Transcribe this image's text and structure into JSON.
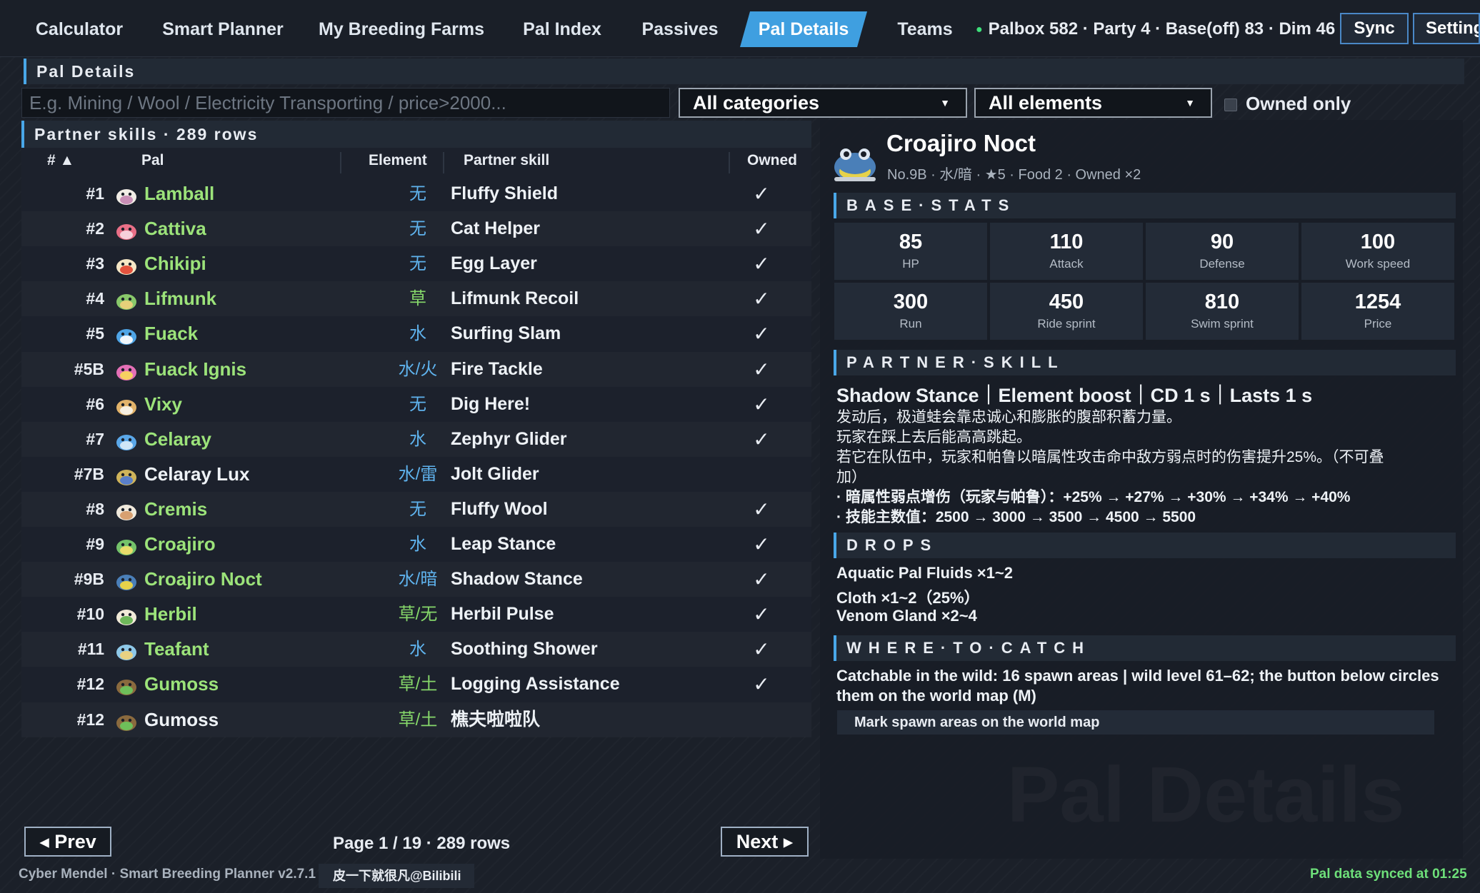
{
  "nav": {
    "tabs": [
      {
        "label": "Calculator",
        "active": false
      },
      {
        "label": "Smart Planner",
        "active": false
      },
      {
        "label": "My Breeding Farms",
        "active": false
      },
      {
        "label": "Pal Index",
        "active": false
      },
      {
        "label": "Passives",
        "active": false
      },
      {
        "label": "Pal Details",
        "active": true
      },
      {
        "label": "Teams",
        "active": false
      }
    ],
    "status": "Palbox 582 · Party 4 · Base(off) 83 · Dim 46",
    "sync_label": "Sync",
    "settings_label": "Settings"
  },
  "section_title": "Pal Details",
  "filters": {
    "search_placeholder": "E.g. Mining / Wool / Electricity Transporting / price>2000...",
    "category": "All categories",
    "element": "All elements",
    "owned_only_label": "Owned only"
  },
  "table": {
    "title": "Partner skills · 289 rows",
    "headers": {
      "num": "# ▲",
      "pal": "Pal",
      "element": "Element",
      "skill": "Partner skill",
      "owned": "Owned"
    },
    "rows": [
      {
        "num": "#1",
        "pal": "Lamball",
        "element": "无",
        "skill": "Fluffy Shield",
        "owned": "✓",
        "icon": "lamball-icon"
      },
      {
        "num": "#2",
        "pal": "Cattiva",
        "element": "无",
        "skill": "Cat Helper",
        "owned": "✓",
        "icon": "cattiva-icon"
      },
      {
        "num": "#3",
        "pal": "Chikipi",
        "element": "无",
        "skill": "Egg Layer",
        "owned": "✓",
        "icon": "chikipi-icon"
      },
      {
        "num": "#4",
        "pal": "Lifmunk",
        "element": "草",
        "skill": "Lifmunk Recoil",
        "owned": "✓",
        "icon": "lifmunk-icon"
      },
      {
        "num": "#5",
        "pal": "Fuack",
        "element": "水",
        "skill": "Surfing Slam",
        "owned": "✓",
        "icon": "fuack-icon"
      },
      {
        "num": "#5B",
        "pal": "Fuack Ignis",
        "element": "水/火",
        "skill": "Fire Tackle",
        "owned": "✓",
        "icon": "fuack-ignis-icon"
      },
      {
        "num": "#6",
        "pal": "Vixy",
        "element": "无",
        "skill": "Dig Here!",
        "owned": "✓",
        "icon": "vixy-icon"
      },
      {
        "num": "#7",
        "pal": "Celaray",
        "element": "水",
        "skill": "Zephyr Glider",
        "owned": "✓",
        "icon": "celaray-icon"
      },
      {
        "num": "#7B",
        "pal": "Celaray Lux",
        "element": "水/雷",
        "skill": "Jolt Glider",
        "owned": "",
        "icon": "celaray-lux-icon"
      },
      {
        "num": "#8",
        "pal": "Cremis",
        "element": "无",
        "skill": "Fluffy Wool",
        "owned": "✓",
        "icon": "cremis-icon"
      },
      {
        "num": "#9",
        "pal": "Croajiro",
        "element": "水",
        "skill": "Leap Stance",
        "owned": "✓",
        "icon": "croajiro-icon"
      },
      {
        "num": "#9B",
        "pal": "Croajiro Noct",
        "element": "水/暗",
        "skill": "Shadow Stance",
        "owned": "✓",
        "icon": "croajiro-noct-icon"
      },
      {
        "num": "#10",
        "pal": "Herbil",
        "element": "草/无",
        "skill": "Herbil Pulse",
        "owned": "✓",
        "icon": "herbil-icon"
      },
      {
        "num": "#11",
        "pal": "Teafant",
        "element": "水",
        "skill": "Soothing Shower",
        "owned": "✓",
        "icon": "teafant-icon"
      },
      {
        "num": "#12",
        "pal": "Gumoss",
        "element": "草/土",
        "skill": "Logging Assistance",
        "owned": "✓",
        "icon": "gumoss-icon"
      },
      {
        "num": "#12",
        "pal": "Gumoss",
        "element": "草/土",
        "skill": "樵夫啦啦队",
        "owned": "",
        "icon": "gumoss-icon"
      }
    ]
  },
  "pagination": {
    "prev": "◂ Prev",
    "next": "Next ▸",
    "info": "Page 1 / 19 · 289 rows"
  },
  "footer": {
    "app": "Cyber Mendel · Smart Breeding Planner v2.7.1",
    "credit": "皮一下就很凡@Bilibili",
    "synced": "Pal data synced at 01:25"
  },
  "detail": {
    "name": "Croajiro Noct",
    "subtitle": "No.9B · 水/暗 · ★5 · Food 2 · Owned ×2",
    "base_stats_title": "BASE·STATS",
    "stats": [
      {
        "value": "85",
        "label": "HP"
      },
      {
        "value": "110",
        "label": "Attack"
      },
      {
        "value": "90",
        "label": "Defense"
      },
      {
        "value": "100",
        "label": "Work speed"
      },
      {
        "value": "300",
        "label": "Run"
      },
      {
        "value": "450",
        "label": "Ride sprint"
      },
      {
        "value": "810",
        "label": "Swim sprint"
      },
      {
        "value": "1254",
        "label": "Price"
      }
    ],
    "partner_title": "PARTNER·SKILL",
    "partner_skill_title": "Shadow Stance｜Element boost｜CD 1 s｜Lasts 1 s",
    "partner_lines": [
      "发动后，极道蛙会靠忠诚心和膨胀的腹部积蓄力量。",
      "玩家在踩上去后能高高跳起。",
      "若它在队伍中，玩家和帕鲁以暗属性攻击命中敌方弱点时的伤害提升25%。（不可叠",
      "加）",
      "· 暗属性弱点增伤（玩家与帕鲁）：+25% → +27% → +30% → +34% → +40%",
      "· 技能主数值：2500 → 3000 → 3500 → 4500 → 5500"
    ],
    "drops_title": "DROPS",
    "drops": [
      "Aquatic Pal Fluids ×1~2",
      "Cloth ×1~2（25%）",
      "Venom Gland ×2~4"
    ],
    "catch_title": "WHERE·TO·CATCH",
    "catch_lines": [
      "Catchable in the wild: 16 spawn areas | wild level 61–62; the button below circles",
      "them on the world map (M)"
    ],
    "mark_button": "Mark spawn areas on the world map",
    "watermark": "Pal Details"
  },
  "colors": {
    "accent": "#3f9fe0",
    "owned_name": "#9ce37a",
    "element_blue": "#5fb3ee",
    "element_green": "#86d86a"
  }
}
